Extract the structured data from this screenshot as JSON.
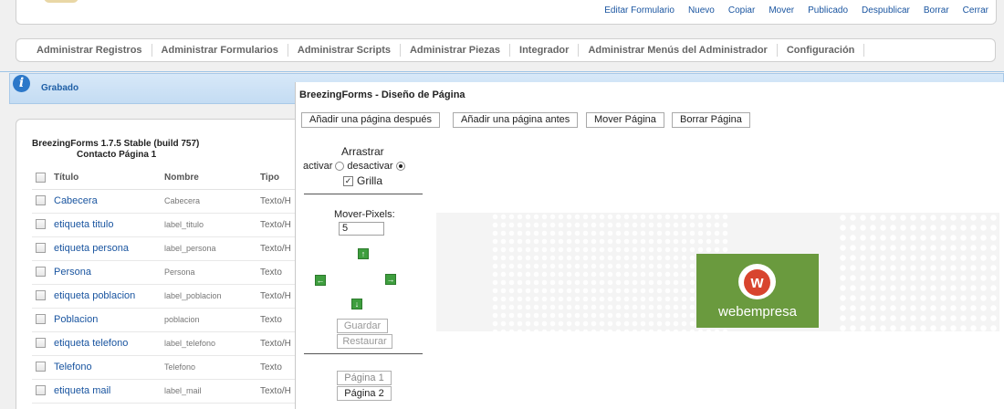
{
  "toolbar": {
    "links": [
      "Editar Formulario",
      "Nuevo",
      "Copiar",
      "Mover",
      "Publicado",
      "Despublicar",
      "Borrar",
      "Cerrar"
    ]
  },
  "menu": {
    "items": [
      "Administrar Registros",
      "Administrar Formularios",
      "Administrar Scripts",
      "Administrar Piezas",
      "Integrador",
      "Administrar Menús del Administrador",
      "Configuración"
    ]
  },
  "message": {
    "text": "Grabado",
    "icon": "info-icon"
  },
  "form": {
    "version": "BreezingForms 1.7.5 Stable (build 757)",
    "page": "Contacto Página 1",
    "columns": [
      "Título",
      "Nombre",
      "Tipo"
    ],
    "rows": [
      {
        "title": "Cabecera",
        "name": "Cabecera",
        "type": "Texto/H"
      },
      {
        "title": "etiqueta titulo",
        "name": "label_titulo",
        "type": "Texto/H"
      },
      {
        "title": "etiqueta persona",
        "name": "label_persona",
        "type": "Texto/H"
      },
      {
        "title": "Persona",
        "name": "Persona",
        "type": "Texto"
      },
      {
        "title": "etiqueta poblacion",
        "name": "label_poblacion",
        "type": "Texto/H"
      },
      {
        "title": "Poblacion",
        "name": "poblacion",
        "type": "Texto"
      },
      {
        "title": "etiqueta telefono",
        "name": "label_telefono",
        "type": "Texto/H"
      },
      {
        "title": "Telefono",
        "name": "Telefono",
        "type": "Texto"
      },
      {
        "title": "etiqueta mail",
        "name": "label_mail",
        "type": "Texto/H"
      }
    ]
  },
  "designer": {
    "title": "BreezingForms - Diseño de Página",
    "buttons": {
      "add_after": "Añadir una página después",
      "add_before": "Añadir una página antes",
      "move": "Mover Página",
      "delete": "Borrar Página"
    },
    "drag_label": "Arrastrar",
    "activate": "activar",
    "deactivate": "desactivar",
    "grid_label": "Grilla",
    "move_pixels_label": "Mover-Pixels:",
    "move_pixels_value": "5",
    "save": "Guardar",
    "restore": "Restaurar",
    "pages": [
      "Página 1",
      "Página 2"
    ],
    "brand": "webempresa",
    "brand_mark": "w"
  },
  "colors": {
    "link": "#1a55a0",
    "message_bg": "#d7e8f8",
    "brand_green": "#6a9a3e",
    "brand_red": "#d8442e",
    "arrow_green": "#3e9e3e"
  }
}
